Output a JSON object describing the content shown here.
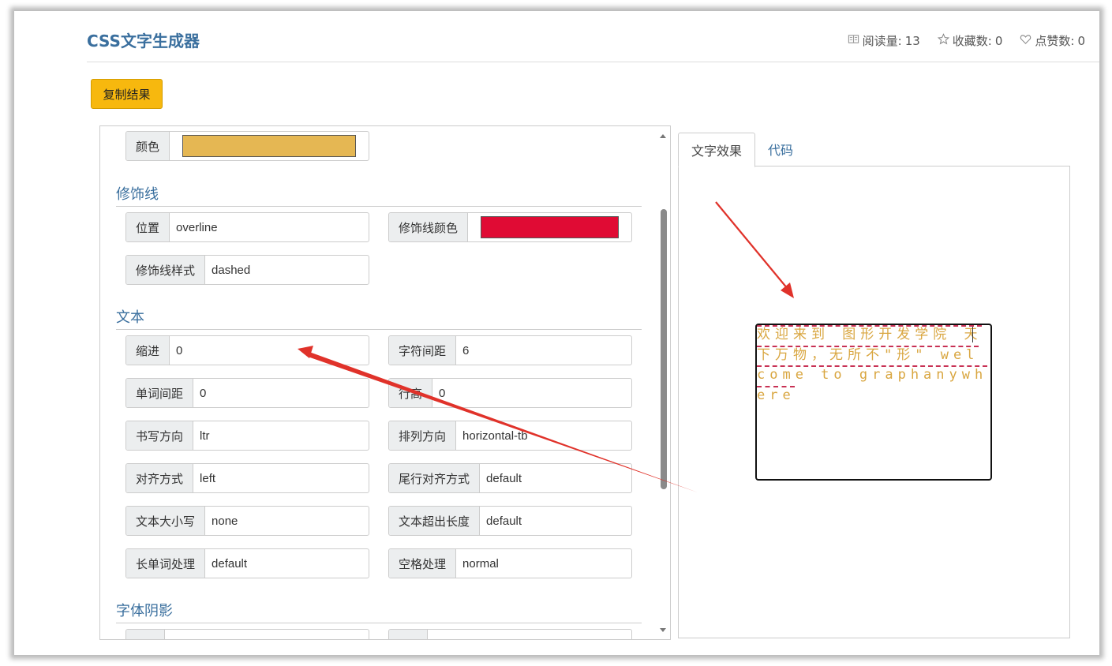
{
  "header": {
    "title": "CSS文字生成器",
    "reads_label": "阅读量:",
    "reads_value": "13",
    "favorites_label": "收藏数:",
    "favorites_value": "0",
    "likes_label": "点赞数:",
    "likes_value": "0"
  },
  "toolbar": {
    "copy_label": "复制结果"
  },
  "form": {
    "color": {
      "label": "颜色",
      "value": "#e5b753"
    },
    "decoration_section": "修饰线",
    "position": {
      "label": "位置",
      "value": "overline"
    },
    "decoration_color": {
      "label": "修饰线颜色",
      "value": "#e00b34"
    },
    "decoration_style": {
      "label": "修饰线样式",
      "value": "dashed"
    },
    "text_section": "文本",
    "indent": {
      "label": "缩进",
      "value": "0"
    },
    "letter_spacing": {
      "label": "字符间距",
      "value": "6"
    },
    "word_spacing": {
      "label": "单词间距",
      "value": "0"
    },
    "line_height": {
      "label": "行高",
      "value": "0"
    },
    "direction": {
      "label": "书写方向",
      "value": "ltr"
    },
    "writing_mode": {
      "label": "排列方向",
      "value": "horizontal-tb"
    },
    "align": {
      "label": "对齐方式",
      "value": "left"
    },
    "align_last": {
      "label": "尾行对齐方式",
      "value": "default"
    },
    "transform": {
      "label": "文本大小写",
      "value": "none"
    },
    "overflow": {
      "label": "文本超出长度",
      "value": "default"
    },
    "word_break": {
      "label": "长单词处理",
      "value": "default"
    },
    "white_space": {
      "label": "空格处理",
      "value": "normal"
    },
    "shadow_section": "字体阴影"
  },
  "tabs": {
    "effect": "文字效果",
    "code": "代码"
  },
  "preview": {
    "text": "欢迎来到 图形开发学院 天下万物，无所不\"形\" welcome to graphanywhere",
    "text_color": "#d9a640",
    "decoration_color": "#c0143c"
  },
  "colors": {
    "accent": "#3a6f9e",
    "button": "#f7b80e",
    "arrow": "#e0322a"
  }
}
